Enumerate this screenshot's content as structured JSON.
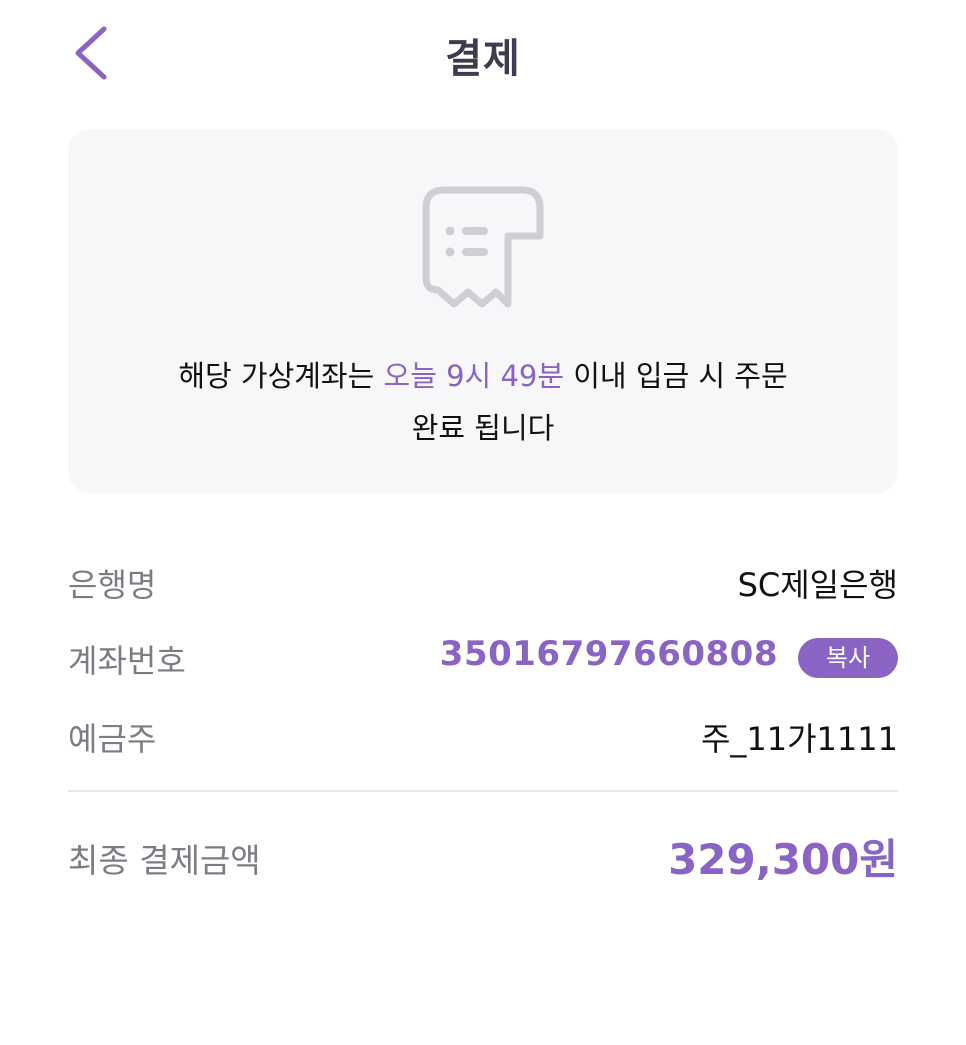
{
  "header": {
    "title": "결제",
    "back_icon": "chevron-left-icon"
  },
  "colors": {
    "accent": "#8a64c4",
    "card_background": "#f7f7f9",
    "label_gray": "#7c7c84",
    "divider": "#e7e7ea",
    "icon_gray": "#cfcfd3"
  },
  "notice": {
    "icon": "receipt-icon",
    "text_before": "해당 가상계좌는 ",
    "deadline": "오늘 9시 49분",
    "text_after": " 이내 입금 시 주문",
    "line2": "완료 됩니다"
  },
  "payment_info": {
    "bank_label": "은행명",
    "bank_value": "SC제일은행",
    "account_label": "계좌번호",
    "account_value": "35016797660808",
    "copy_label": "복사",
    "holder_label": "예금주",
    "holder_value": "주_11가1111"
  },
  "total": {
    "label": "최종 결제금액",
    "value": "329,300원"
  }
}
